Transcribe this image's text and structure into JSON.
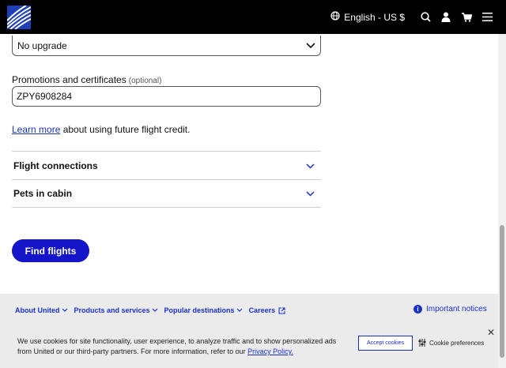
{
  "header": {
    "language_label": "English - US $",
    "icons": [
      "globe-icon",
      "search-icon",
      "user-icon",
      "cart-icon",
      "menu-icon"
    ]
  },
  "form": {
    "upgrade_value": "No upgrade",
    "promo_label": "Promotions and certificates",
    "promo_optional": "(optional)",
    "promo_value": "ZPY6908284",
    "learn_link": "Learn more",
    "learn_rest": " about using future flight credit.",
    "accordions": [
      "Flight connections",
      "Pets in cabin"
    ],
    "find_button": "Find flights"
  },
  "footer": {
    "nav": [
      "About United",
      "Products and services",
      "Popular destinations",
      "Careers"
    ],
    "notices": "Important notices"
  },
  "cookie": {
    "text": "We use cookies for site functionality, user experience, to analyze traffic and to show personalized ads from United or our third-party partners. For more information, refer to our ",
    "policy_link": "Privacy Policy.",
    "accept": "Accept cookies",
    "prefs": "Cookie preferences",
    "close": "✕"
  },
  "colors": {
    "brand_blue": "#1414c9",
    "link_blue": "#1a31c9",
    "header_bg": "#000000",
    "footer_bg": "#ebebeb"
  }
}
